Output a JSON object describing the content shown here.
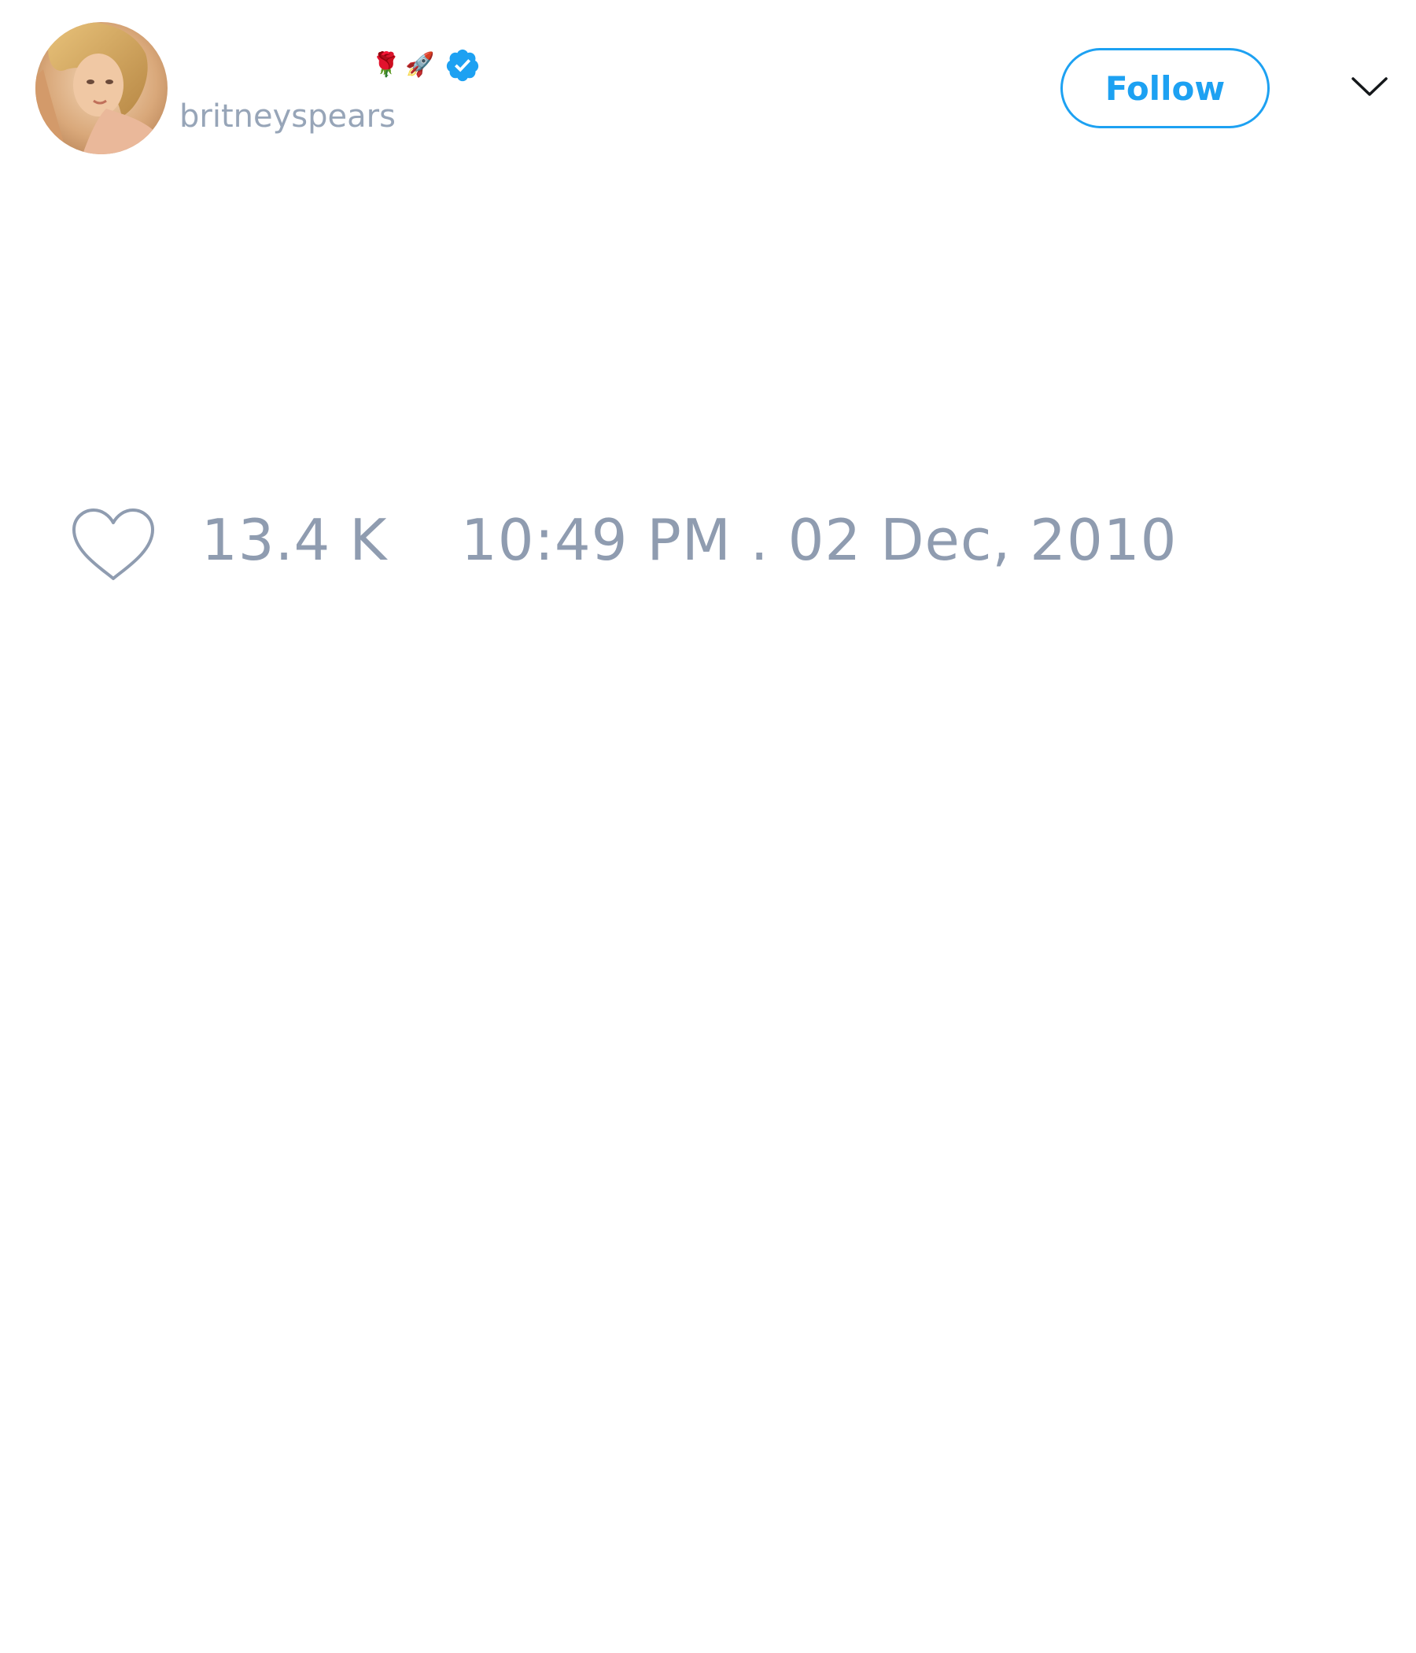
{
  "user": {
    "display_name": "",
    "name_emojis": [
      "🌹",
      "🚀"
    ],
    "verified": true,
    "handle": "britneyspears",
    "avatar_icon": "profile-photo"
  },
  "actions": {
    "follow_label": "Follow",
    "menu_icon": "chevron-down-icon"
  },
  "stats": {
    "like_icon": "heart-outline-icon",
    "likes_count": "13.4 K",
    "timestamp": "10:49 PM . 02 Dec, 2010"
  },
  "colors": {
    "accent": "#1da1f2",
    "muted_text": "#8f9cb0",
    "background": "#ffffff"
  }
}
